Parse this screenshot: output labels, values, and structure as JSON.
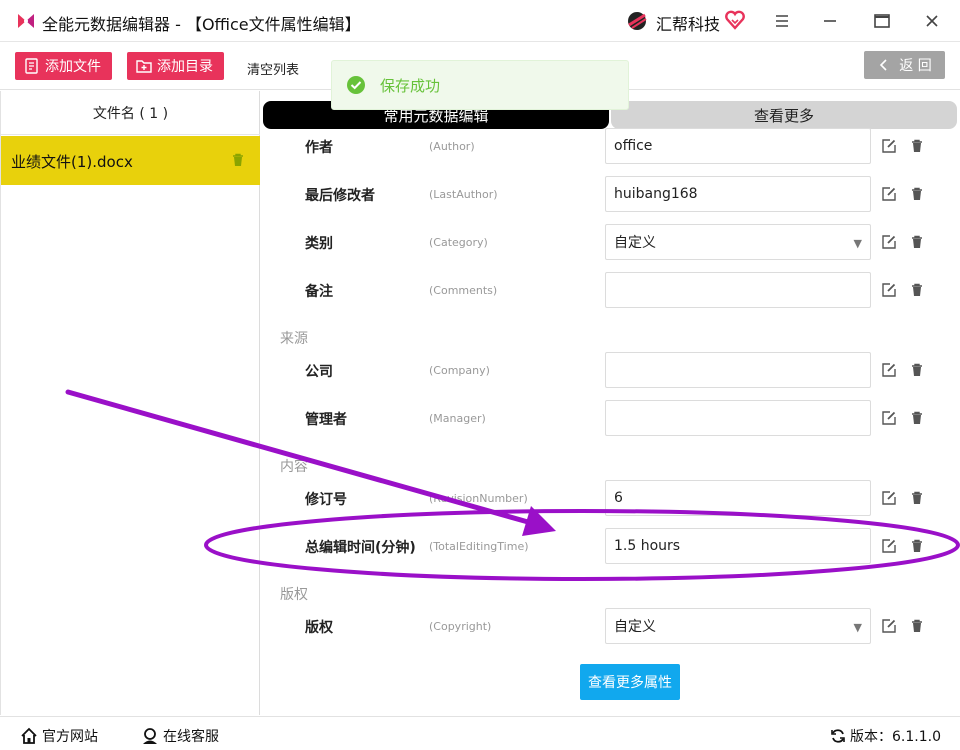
{
  "titlebar": {
    "title": "全能元数据编辑器 - 【Office文件属性编辑】",
    "brand": "汇帮科技"
  },
  "toolbar": {
    "add_file": "添加文件",
    "add_dir": "添加目录",
    "clear_list": "清空列表",
    "back": "返 回"
  },
  "toast": {
    "text": "保存成功"
  },
  "file_list": {
    "header": "文件名 ( 1 )",
    "items": [
      {
        "name": "业绩文件(1).docx"
      }
    ]
  },
  "tabs": {
    "common": "常用元数据编辑",
    "more": "查看更多"
  },
  "sections": {
    "source": "来源",
    "content": "内容",
    "copyright": "版权"
  },
  "fields": {
    "author": {
      "label": "作者",
      "en": "(Author)",
      "value": "office"
    },
    "last_author": {
      "label": "最后修改者",
      "en": "(LastAuthor)",
      "value": "huibang168"
    },
    "category": {
      "label": "类别",
      "en": "(Category)",
      "value": "自定义"
    },
    "comments": {
      "label": "备注",
      "en": "(Comments)",
      "value": ""
    },
    "company": {
      "label": "公司",
      "en": "(Company)",
      "value": ""
    },
    "manager": {
      "label": "管理者",
      "en": "(Manager)",
      "value": ""
    },
    "revision": {
      "label": "修订号",
      "en": "(RevisionNumber)",
      "value": "6"
    },
    "editing_time": {
      "label": "总编辑时间(分钟)",
      "en": "(TotalEditingTime)",
      "value": "1.5 hours"
    },
    "copyright": {
      "label": "版权",
      "en": "(Copyright)",
      "value": "自定义"
    }
  },
  "more_props_button": "查看更多属性",
  "footer": {
    "website": "官方网站",
    "support": "在线客服",
    "version": "版本：6.1.1.0"
  },
  "colors": {
    "accent_red": "#e8335b",
    "selected_file": "#e8d10c",
    "annotation_purple": "#9a10c8",
    "more_button_blue": "#11a8ee",
    "toast_green": "#67c23a"
  }
}
